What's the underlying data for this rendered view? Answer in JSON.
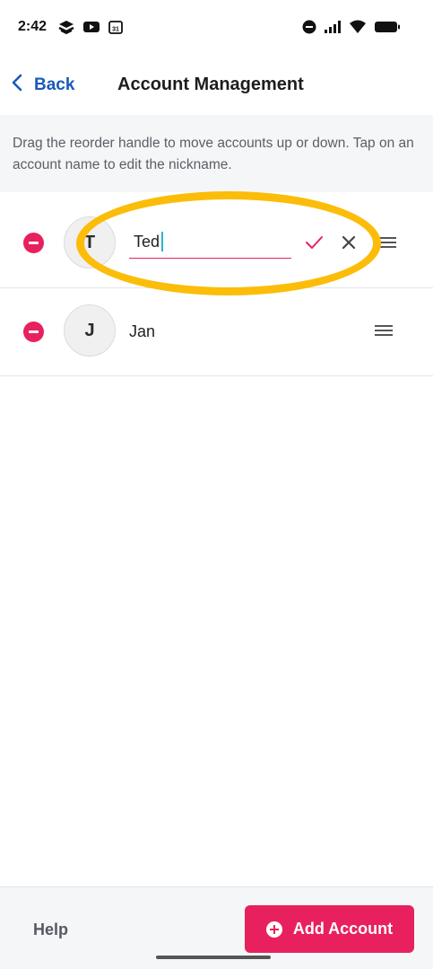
{
  "status_bar": {
    "time": "2:42",
    "left_icons": [
      "stack-app-icon",
      "youtube-icon",
      "calendar-icon"
    ],
    "calendar_day": "31",
    "right_icons": [
      "do-not-disturb-icon",
      "signal-icon",
      "wifi-icon",
      "battery-icon"
    ]
  },
  "header": {
    "back_label": "Back",
    "title": "Account Management"
  },
  "info_text": "Drag the reorder handle to move accounts up or down. Tap on an account name to edit the nickname.",
  "accounts": [
    {
      "initial": "T",
      "name": "Ted",
      "editing": true
    },
    {
      "initial": "J",
      "name": "Jan",
      "editing": false
    }
  ],
  "footer": {
    "help_label": "Help",
    "add_label": "Add Account"
  },
  "colors": {
    "accent": "#e8215e",
    "link": "#1a5ab8",
    "highlight": "#fbbd09"
  }
}
